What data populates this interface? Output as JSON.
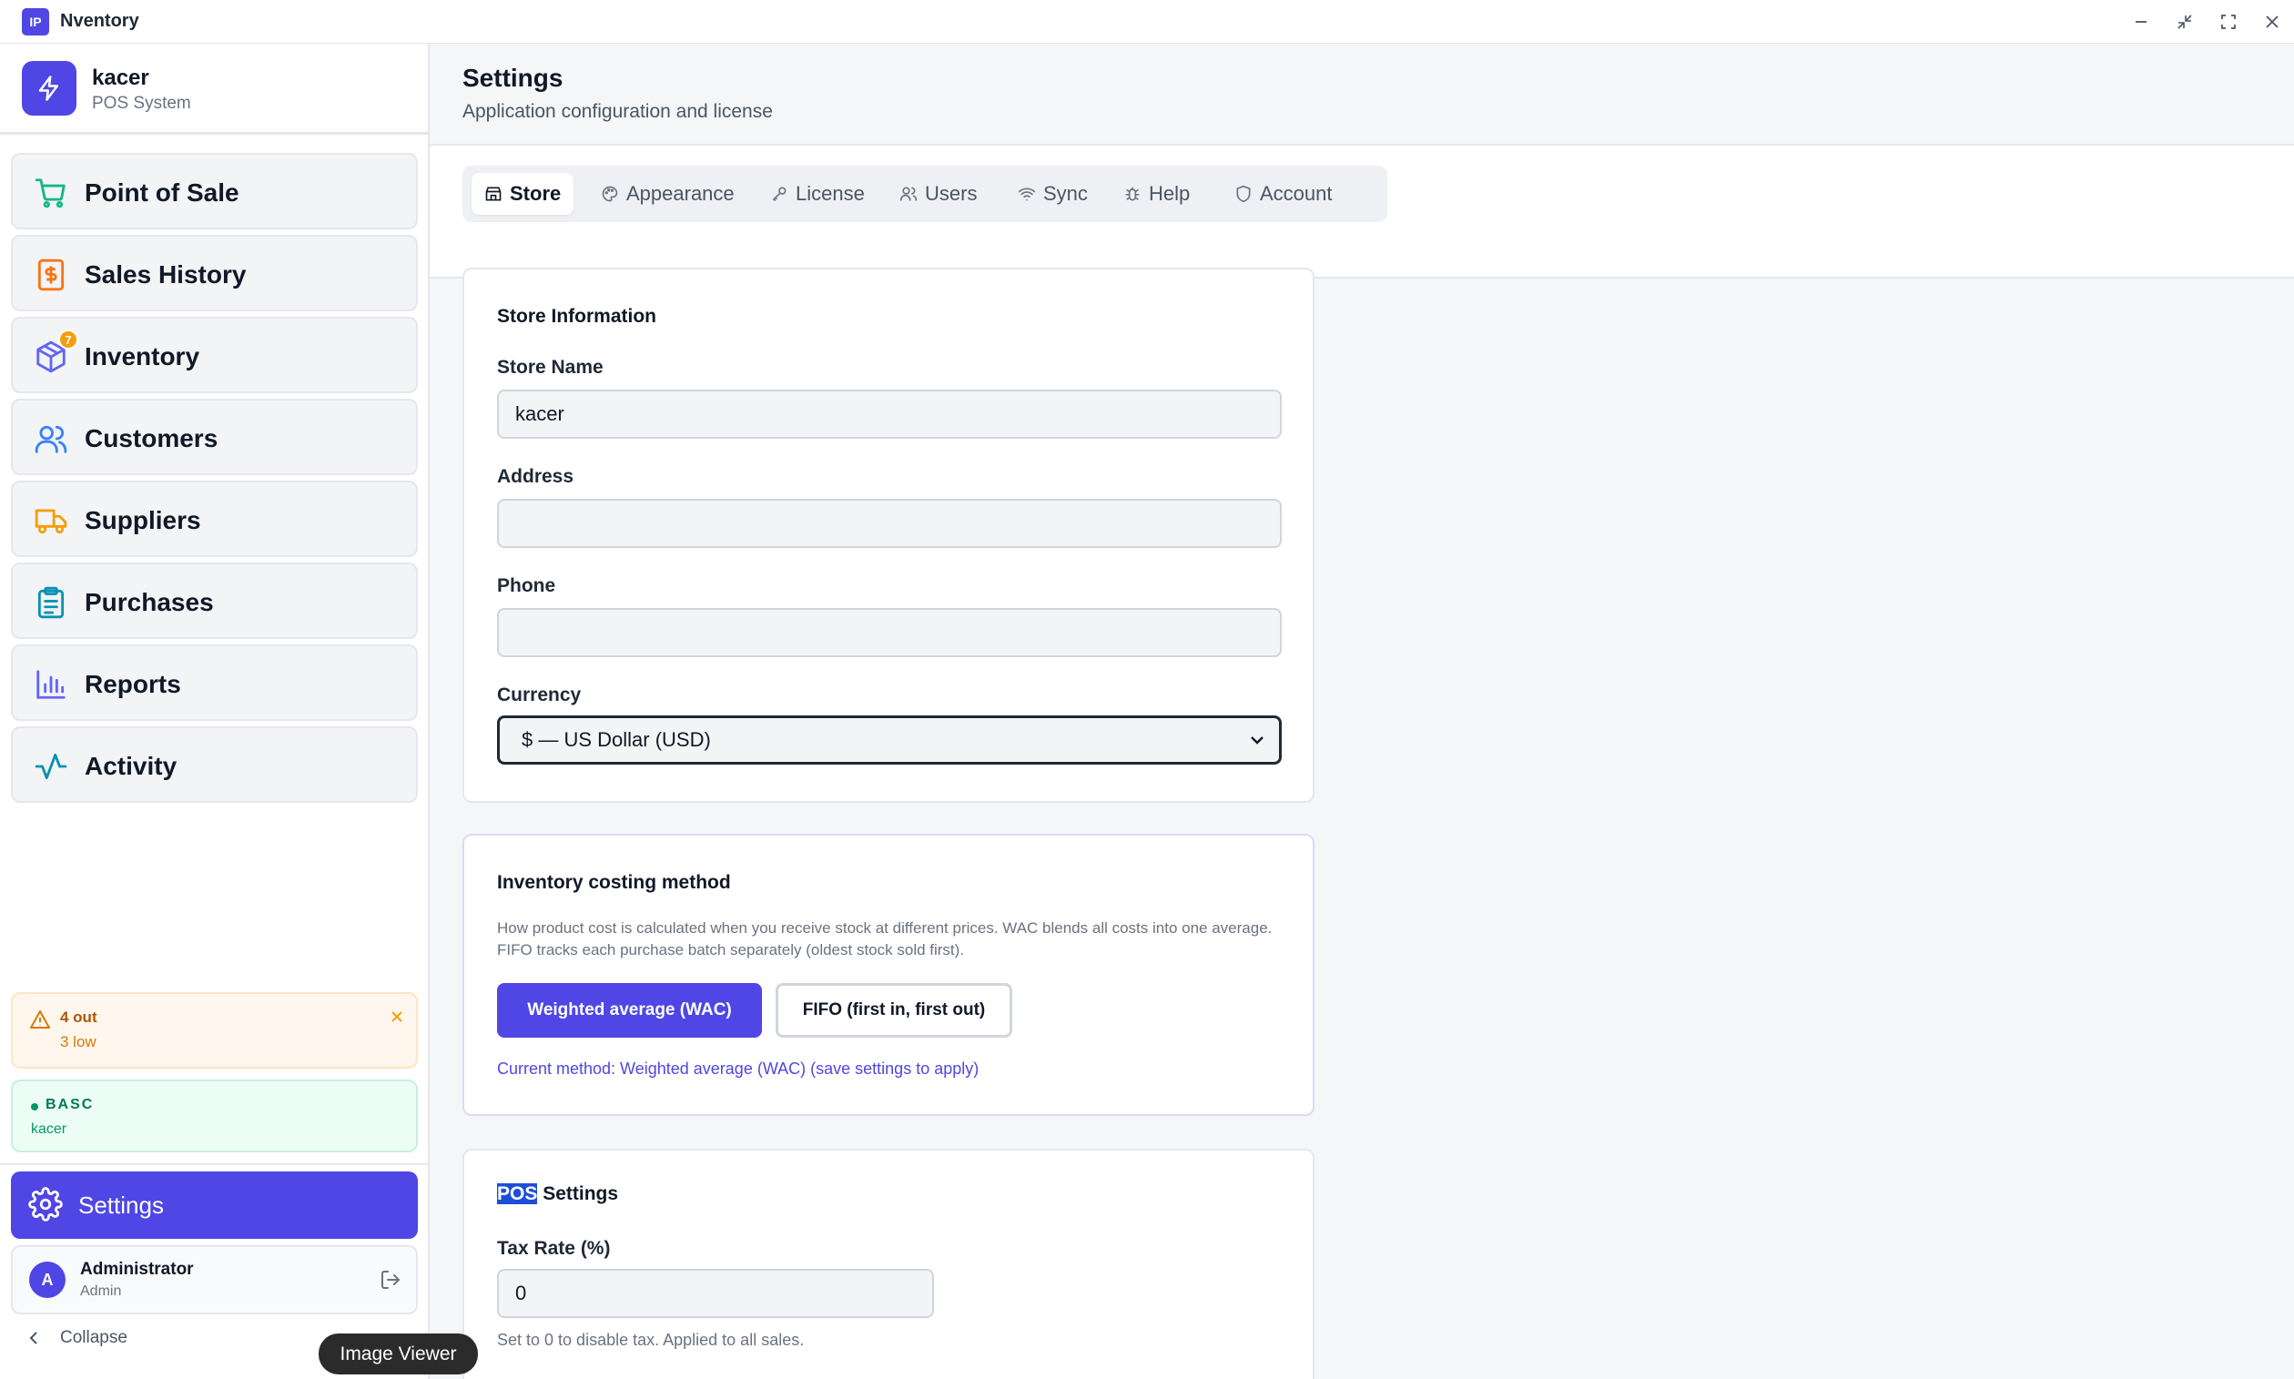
{
  "window": {
    "app_icon_text": "IP",
    "title": "Nventory"
  },
  "sidebar": {
    "brand": {
      "name": "kacer",
      "subtitle": "POS System"
    },
    "items": [
      {
        "label": "Point of Sale",
        "icon": "cart-icon"
      },
      {
        "label": "Sales History",
        "icon": "dollar-receipt-icon"
      },
      {
        "label": "Inventory",
        "icon": "box-icon",
        "badge": "7"
      },
      {
        "label": "Customers",
        "icon": "users-icon"
      },
      {
        "label": "Suppliers",
        "icon": "truck-icon"
      },
      {
        "label": "Purchases",
        "icon": "clipboard-icon"
      },
      {
        "label": "Reports",
        "icon": "bar-chart-icon"
      },
      {
        "label": "Activity",
        "icon": "activity-icon"
      }
    ],
    "stock_alert": {
      "out": "4 out",
      "low": "3 low"
    },
    "license": {
      "plan": "BASC",
      "name": "kacer"
    },
    "settings_label": "Settings",
    "user": {
      "initial": "A",
      "name": "Administrator",
      "role": "Admin"
    },
    "collapse_label": "Collapse"
  },
  "tooltip": "Image Viewer",
  "header": {
    "title": "Settings",
    "subtitle": "Application configuration and license"
  },
  "tabs": [
    {
      "label": "Store",
      "icon": "store-icon",
      "active": true
    },
    {
      "label": "Appearance",
      "icon": "palette-icon"
    },
    {
      "label": "License",
      "icon": "key-icon"
    },
    {
      "label": "Users",
      "icon": "users-icon"
    },
    {
      "label": "Sync",
      "icon": "wifi-icon"
    },
    {
      "label": "Help",
      "icon": "bug-icon"
    },
    {
      "label": "Account",
      "icon": "shield-icon"
    }
  ],
  "store_info": {
    "title": "Store Information",
    "store_name_label": "Store Name",
    "store_name_value": "kacer",
    "address_label": "Address",
    "address_value": "",
    "phone_label": "Phone",
    "phone_value": "",
    "currency_label": "Currency",
    "currency_value": "$ — US Dollar (USD)"
  },
  "costing": {
    "title": "Inventory costing method",
    "description": "How product cost is calculated when you receive stock at different prices. WAC blends all costs into one average. FIFO tracks each purchase batch separately (oldest stock sold first).",
    "wac_label": "Weighted average (WAC)",
    "fifo_label": "FIFO (first in, first out)",
    "current_method": "Current method: Weighted average (WAC) (save settings to apply)"
  },
  "pos_settings": {
    "title_highlight": "POS",
    "title_rest": " Settings",
    "tax_label": "Tax Rate (%)",
    "tax_value": "0",
    "tax_hint": "Set to 0 to disable tax. Applied to all sales."
  },
  "colors": {
    "accent": "#4f46e5",
    "alert_bg": "#fff7ed",
    "license_bg": "#ecfdf5"
  }
}
